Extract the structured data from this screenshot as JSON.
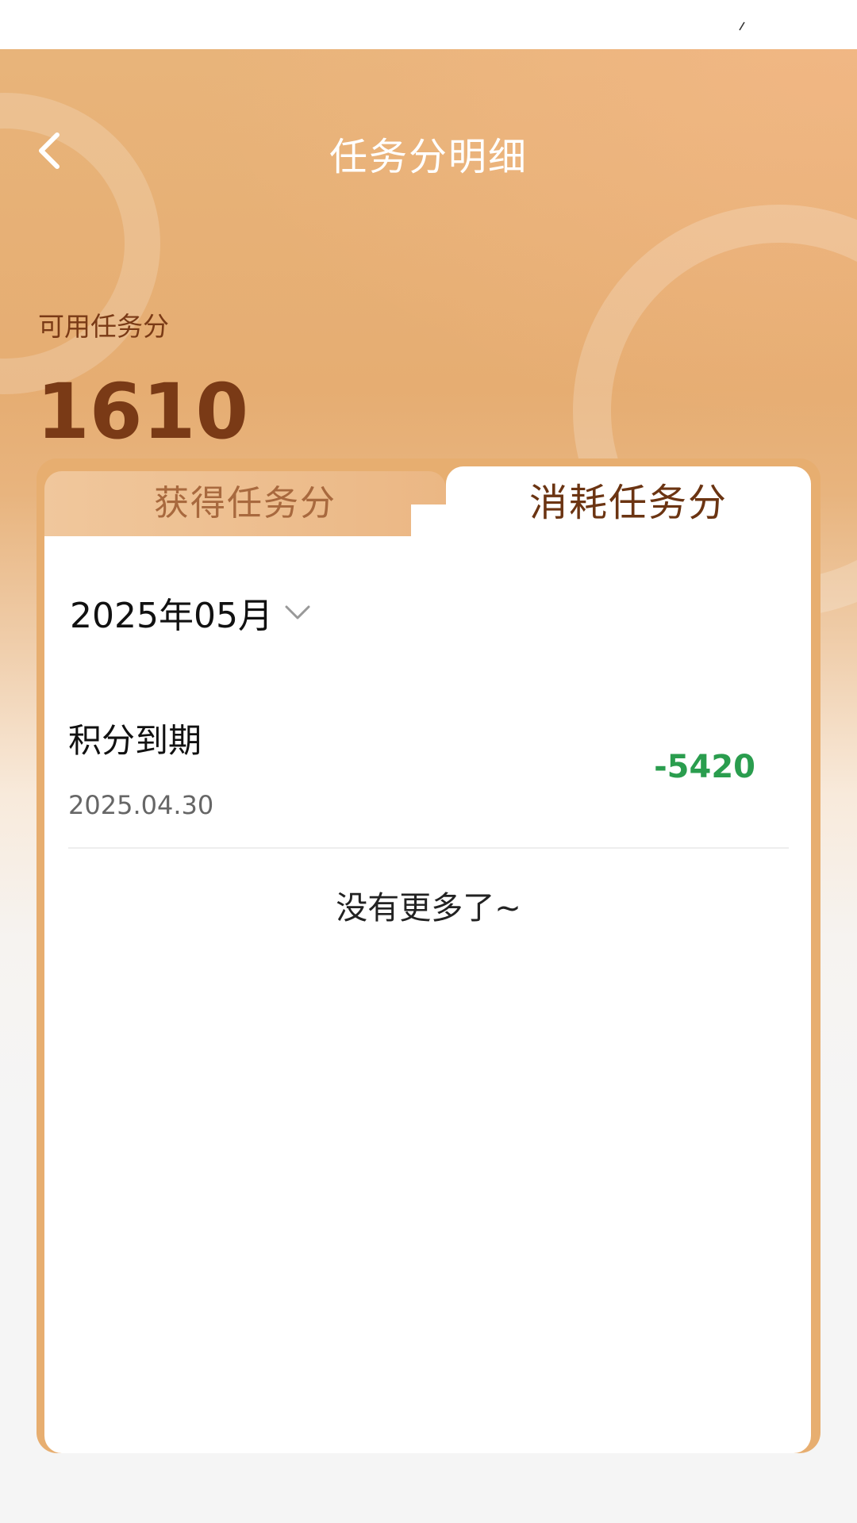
{
  "header": {
    "title": "任务分明细",
    "back_icon": "chevron-left-icon"
  },
  "balance": {
    "label": "可用任务分",
    "value": "1610"
  },
  "tabs": [
    {
      "label": "获得任务分",
      "active": false
    },
    {
      "label": "消耗任务分",
      "active": true
    }
  ],
  "filter": {
    "month": "2025年05月",
    "icon": "chevron-down-icon"
  },
  "records": [
    {
      "title": "积分到期",
      "date": "2025.04.30",
      "amount": "-5420"
    }
  ],
  "list_end_text": "没有更多了~",
  "colors": {
    "header_bg": "#e8b47a",
    "accent_brown": "#7a3a16",
    "amount_green": "#2a9d4e"
  }
}
